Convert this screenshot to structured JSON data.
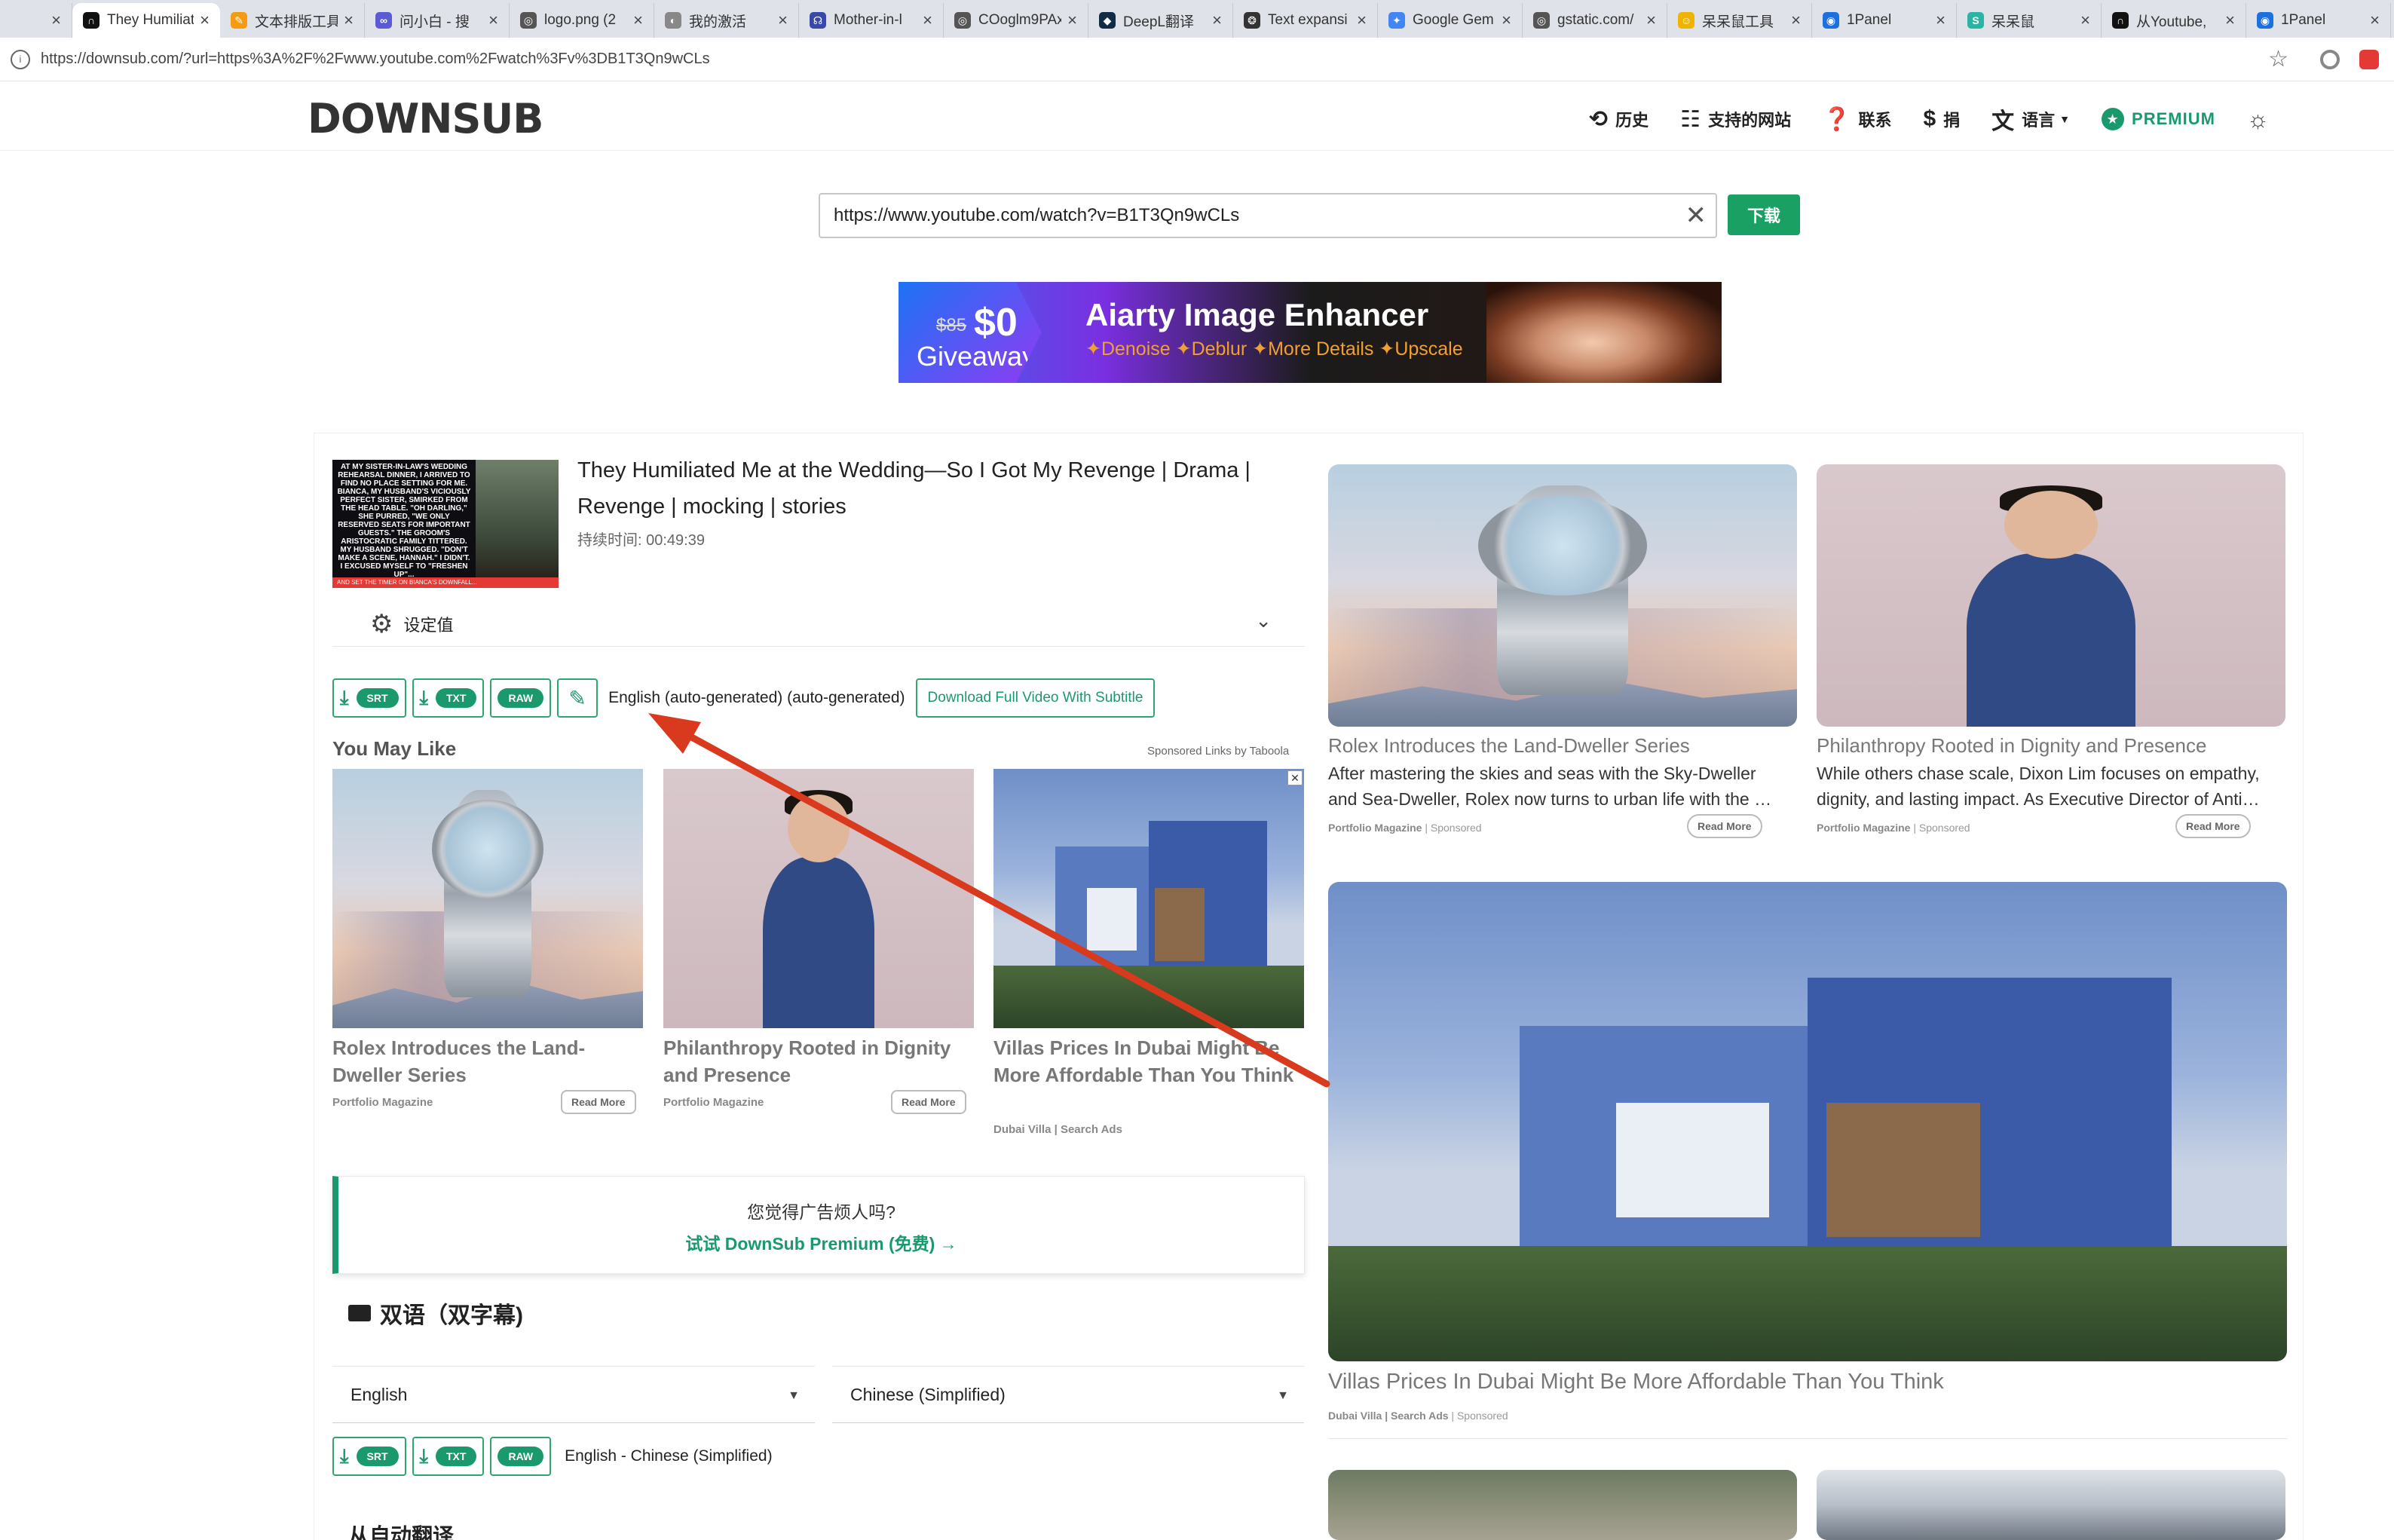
{
  "browser": {
    "tabs": [
      {
        "title": "",
        "color": "#999999",
        "glyph": ""
      },
      {
        "title": "They Humiliat",
        "color": "#111111",
        "glyph": "∩"
      },
      {
        "title": "文本排版工具",
        "color": "#f39c12",
        "glyph": "✎"
      },
      {
        "title": "问小白 - 搜",
        "color": "#5b5bd6",
        "glyph": "∞"
      },
      {
        "title": "logo.png (2",
        "color": "#555555",
        "glyph": "◎"
      },
      {
        "title": "我的激活",
        "color": "#888888",
        "glyph": "◐"
      },
      {
        "title": "Mother-in-l",
        "color": "#3949ab",
        "glyph": "☊"
      },
      {
        "title": "COoglm9PAx",
        "color": "#555555",
        "glyph": "◎"
      },
      {
        "title": "DeepL翻译",
        "color": "#0f2b46",
        "glyph": "◆"
      },
      {
        "title": "Text expansi",
        "color": "#333333",
        "glyph": "❂"
      },
      {
        "title": "Google Gem",
        "color": "#4285f4",
        "glyph": "✦"
      },
      {
        "title": "gstatic.com/",
        "color": "#555555",
        "glyph": "◎"
      },
      {
        "title": "呆呆鼠工具",
        "color": "#f0b400",
        "glyph": "☺"
      },
      {
        "title": "1Panel",
        "color": "#1e6fe0",
        "glyph": "◉"
      },
      {
        "title": "呆呆鼠",
        "color": "#2bb3a3",
        "glyph": "S"
      },
      {
        "title": "从Youtube,",
        "color": "#111111",
        "glyph": "∩"
      },
      {
        "title": "1Panel",
        "color": "#1e6fe0",
        "glyph": "◉"
      }
    ],
    "url": "https://downsub.com/?url=https%3A%2F%2Fwww.youtube.com%2Fwatch%3Fv%3DB1T3Qn9wCLs"
  },
  "header": {
    "logo": "DOWNSUB",
    "nav": {
      "history": "历史",
      "supported_sites": "支持的网站",
      "contact": "联系",
      "donate": "捐",
      "language": "语言",
      "premium": "PREMIUM"
    }
  },
  "search": {
    "value": "https://www.youtube.com/watch?v=B1T3Qn9wCLs",
    "button": "下载"
  },
  "banner": {
    "old_price": "$85",
    "price": "$0",
    "giveaway": "Giveaway",
    "title": "Aiarty Image Enhancer",
    "features": "✦Denoise ✦Deblur ✦More Details ✦Upscale"
  },
  "video": {
    "thumb_text": "AT MY SISTER-IN-LAW'S WEDDING REHEARSAL DINNER, I ARRIVED TO FIND NO PLACE SETTING FOR ME. BIANCA, MY HUSBAND'S VICIOUSLY PERFECT SISTER, SMIRKED FROM THE HEAD TABLE. \"OH DARLING,\" SHE PURRED, \"WE ONLY RESERVED SEATS FOR IMPORTANT GUESTS.\" THE GROOM'S ARISTOCRATIC FAMILY TITTERED. MY HUSBAND SHRUGGED. \"DON'T MAKE A SCENE, HANNAH.\" I DIDN'T. I EXCUSED MYSELF TO \"FRESHEN UP\"...",
    "thumb_bar": "AND SET THE TIMER ON BIANCA'S DOWNFALL...",
    "title": "They Humiliated Me at the Wedding—So I Got My Revenge | Drama | Revenge | mocking | stories",
    "duration": "持续时间: 00:49:39"
  },
  "settings": {
    "label": "设定值"
  },
  "download_row": {
    "formats": [
      "SRT",
      "TXT",
      "RAW"
    ],
    "language": "English (auto-generated) (auto-generated)",
    "full_video": "Download Full Video With Subtitle"
  },
  "you_may_like": {
    "title": "You May Like",
    "sponsored_by": "Sponsored Links by Taboola",
    "cards": [
      {
        "title": "Rolex Introduces the Land-Dweller Series",
        "source": "Portfolio Magazine",
        "action": "Read More"
      },
      {
        "title": "Philanthropy Rooted in Dignity and Presence",
        "source": "Portfolio Magazine",
        "action": "Read More"
      },
      {
        "title": "Villas Prices In Dubai Might Be More Affordable Than You Think",
        "source": "Dubai Villa | Search Ads",
        "action": ""
      }
    ]
  },
  "promo": {
    "question": "您觉得广告烦人吗?",
    "cta": "试试 DownSub Premium (免费) →"
  },
  "bilingual": {
    "title": "双语（双字幕)",
    "left_lang": "English",
    "right_lang": "Chinese (Simplified)",
    "formats": [
      "SRT",
      "TXT",
      "RAW"
    ],
    "pair_label": "English - Chinese (Simplified)"
  },
  "auto_translate": {
    "title": "从自动翻译"
  },
  "right_ads": {
    "card1": {
      "title": "Rolex Introduces the Land-Dweller Series",
      "desc1": "After mastering the skies and seas with the Sky-Dweller",
      "desc2": "and Sea-Dweller, Rolex now turns to urban life with the …",
      "source": "Portfolio Magazine",
      "sponsored": "| Sponsored",
      "action": "Read More"
    },
    "card2": {
      "title": "Philanthropy Rooted in Dignity and Presence",
      "desc1": "While others chase scale, Dixon Lim focuses on empathy,",
      "desc2": "dignity, and lasting impact. As Executive Director of Anti…",
      "source": "Portfolio Magazine",
      "sponsored": "| Sponsored",
      "action": "Read More"
    },
    "card3": {
      "title": "Villas Prices In Dubai Might Be More Affordable Than You Think",
      "source": "Dubai Villa | Search Ads",
      "sponsored": "| Sponsored"
    }
  },
  "colors": {
    "accent": "#1a9a6c",
    "arrow": "#d93a1e"
  }
}
